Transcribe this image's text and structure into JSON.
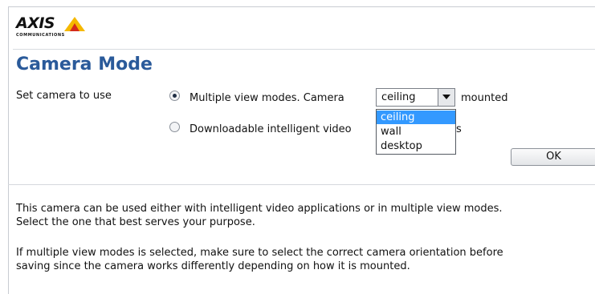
{
  "logo": {
    "name": "AXIS",
    "sub": "COMMUNICATIONS",
    "colors": {
      "triangle": "#f5b800",
      "text": "#111111"
    }
  },
  "page": {
    "title": "Camera Mode"
  },
  "form": {
    "label": "Set camera to use",
    "option1": {
      "text_before": "Multiple view modes. Camera",
      "text_after": "mounted",
      "checked": true
    },
    "option2": {
      "text_visible": "Downloadable intelligent video",
      "text_tail": "s",
      "checked": false
    },
    "mount_select": {
      "value": "ceiling",
      "options": [
        "ceiling",
        "wall",
        "desktop"
      ],
      "highlighted": "ceiling"
    },
    "ok_label": "OK"
  },
  "help": {
    "p1_line1": "This camera can be used either with intelligent video applications or in multiple view modes.",
    "p1_line2": "Select the one that best serves your purpose.",
    "p2_line1": "If multiple view modes is selected, make sure to select the correct camera orientation before",
    "p2_line2": "saving since the camera works differently depending on how it is mounted."
  },
  "colors": {
    "title": "#2a5a9a",
    "highlight": "#3399ff"
  },
  "icons": {
    "dropdown_arrow": "chevron-down-icon"
  }
}
